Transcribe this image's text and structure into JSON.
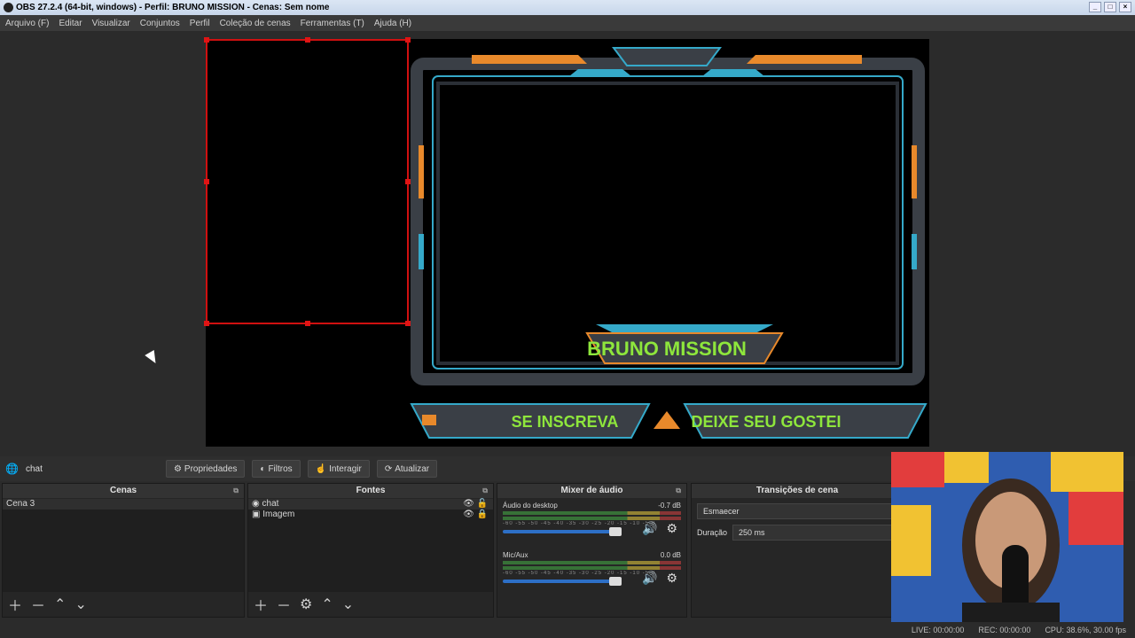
{
  "window": {
    "title": "OBS 27.2.4 (64-bit, windows) - Perfil: BRUNO MISSION - Cenas: Sem nome"
  },
  "menu": [
    "Arquivo (F)",
    "Editar",
    "Visualizar",
    "Conjuntos",
    "Perfil",
    "Coleção de cenas",
    "Ferramentas (T)",
    "Ajuda (H)"
  ],
  "overlay": {
    "name": "BRUNO MISSION",
    "subscribe": "SE INSCREVA",
    "like": "DEIXE SEU GOSTEI",
    "colors": {
      "orange": "#e8892b",
      "cyan": "#35a9c9",
      "green": "#8ee63c",
      "frame": "#3a3f46"
    }
  },
  "source_toolbar": {
    "selected_source": "chat",
    "properties": "Propriedades",
    "filters": "Filtros",
    "interact": "Interagir",
    "refresh": "Atualizar"
  },
  "scenes": {
    "title": "Cenas",
    "items": [
      "Cena 3"
    ]
  },
  "sources": {
    "title": "Fontes",
    "items": [
      "chat",
      "Imagem"
    ]
  },
  "mixer": {
    "title": "Mixer de áudio",
    "tracks": [
      {
        "name": "Áudio do desktop",
        "db": "-0.7 dB"
      },
      {
        "name": "Mic/Aux",
        "db": "0.0 dB"
      }
    ],
    "ticks": "-60 -55 -50 -45 -40 -35 -30 -25 -20 -15 -10 -5 0"
  },
  "transitions": {
    "title": "Transições de cena",
    "type": "Esmaecer",
    "duration_label": "Duração",
    "duration_value": "250 ms"
  },
  "status": {
    "live": "LIVE: 00:00:00",
    "rec": "REC: 00:00:00",
    "cpu": "CPU: 38.6%, 30.00 fps"
  }
}
